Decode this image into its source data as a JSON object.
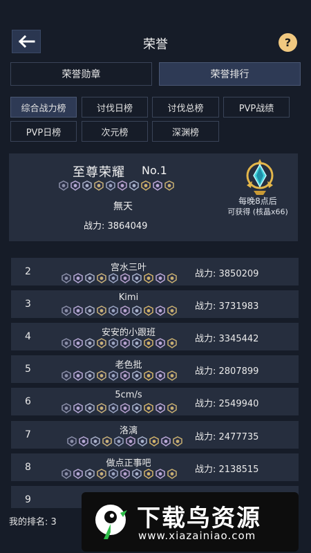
{
  "header": {
    "title": "荣誉",
    "back_icon": "back-arrow-icon",
    "help_label": "?"
  },
  "main_tabs": [
    {
      "label": "荣誉勋章",
      "active": false
    },
    {
      "label": "荣誉排行",
      "active": true
    }
  ],
  "sub_tabs": [
    {
      "label": "综合战力榜",
      "active": true
    },
    {
      "label": "讨伐日榜",
      "active": false
    },
    {
      "label": "讨伐总榜",
      "active": false
    },
    {
      "label": "PVP战绩",
      "active": false
    },
    {
      "label": "PVP日榜",
      "active": false
    },
    {
      "label": "次元榜",
      "active": false
    },
    {
      "label": "深渊榜",
      "active": false
    }
  ],
  "top_player": {
    "rank_title": "至尊荣耀",
    "rank_no": "No.1",
    "name": "無天",
    "power": "战力: 3864049",
    "reward_line1": "每晚8点后",
    "reward_line2": "可获得 (核晶x66)",
    "reward_icon": "crystal-icon"
  },
  "rankings": [
    {
      "rank": "2",
      "name": "宫水三叶",
      "power": "战力: 3850209"
    },
    {
      "rank": "3",
      "name": "Kimi",
      "power": "战力: 3731983"
    },
    {
      "rank": "4",
      "name": "安安的小跟班",
      "power": "战力: 3345442"
    },
    {
      "rank": "5",
      "name": "老色批",
      "power": "战力: 2807899"
    },
    {
      "rank": "6",
      "name": "5cm/s",
      "power": "战力: 2549940"
    },
    {
      "rank": "7",
      "name": "洛漓",
      "power": "战力: 2477735"
    },
    {
      "rank": "8",
      "name": "做点正事吧",
      "power": "战力: 2138515"
    },
    {
      "rank": "9",
      "name": "",
      "power": ""
    }
  ],
  "footer": {
    "my_rank": "我的排名: 3"
  },
  "watermark": {
    "text": "下载鸟资源",
    "url": "www.xiazainiao.com"
  },
  "colors": {
    "background": "#161c28",
    "card": "#262e3e",
    "active_tab": "#2e3a55",
    "help_badge": "#f0c880"
  }
}
